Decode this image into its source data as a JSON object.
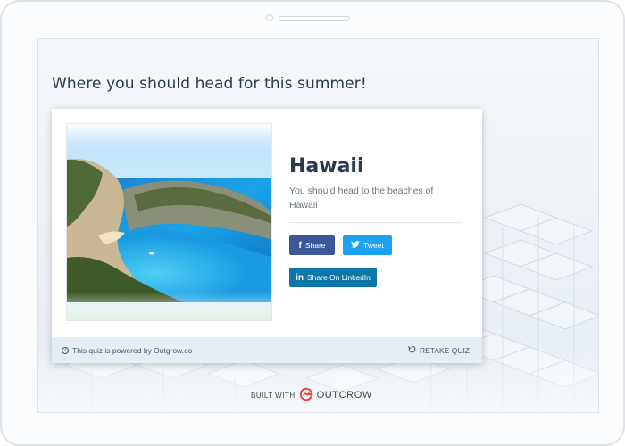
{
  "page": {
    "title": "Where you should head for this summer!"
  },
  "result": {
    "heading": "Hawaii",
    "description": "You should head to the beaches of Hawaii",
    "image_icon": "beach-photo"
  },
  "share": {
    "facebook_label": "Share",
    "twitter_label": "Tweet",
    "linkedin_label": "Share On LinkedIn",
    "facebook_color": "#3b5998",
    "twitter_color": "#1da1f2",
    "linkedin_color": "#0e76a8"
  },
  "footer": {
    "powered_text": "This quiz is powered by Outgrow.co",
    "retake_label": "RETAKE QUIZ"
  },
  "branding": {
    "built_with": "BUILT WITH",
    "brand_name": "OUTCROW",
    "brand_color": "#e5484d"
  }
}
